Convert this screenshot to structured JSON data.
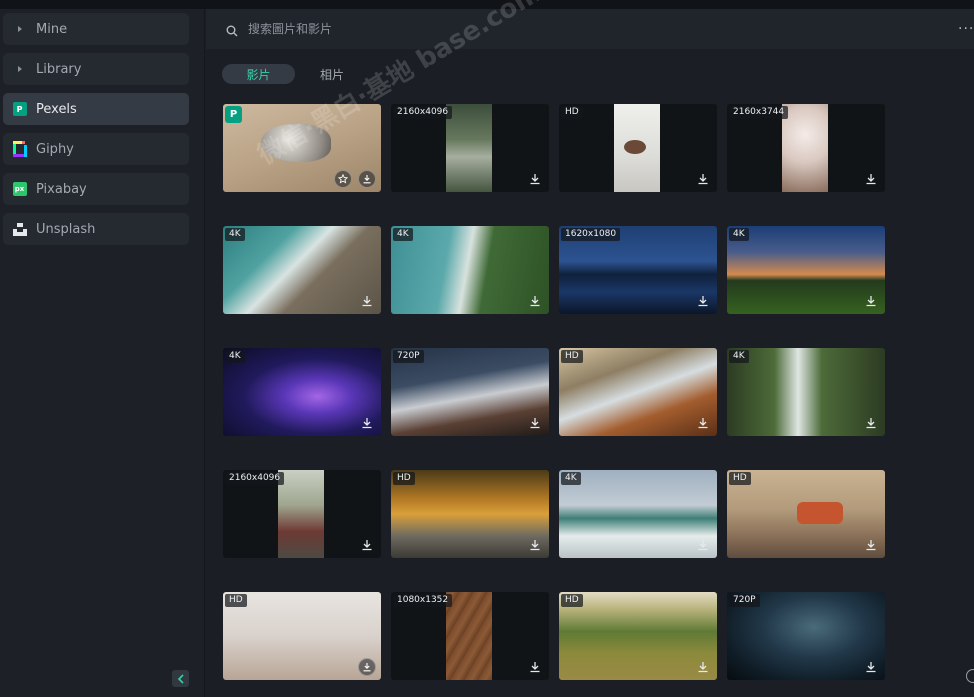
{
  "sidebar": {
    "items": [
      {
        "label": "Mine",
        "icon": "triangle-right-icon"
      },
      {
        "label": "Library",
        "icon": "triangle-right-icon"
      },
      {
        "label": "Pexels",
        "icon": "pexels-logo-icon",
        "active": true
      },
      {
        "label": "Giphy",
        "icon": "giphy-logo-icon"
      },
      {
        "label": "Pixabay",
        "icon": "pixabay-logo-icon"
      },
      {
        "label": "Unsplash",
        "icon": "unsplash-logo-icon"
      }
    ],
    "pexels_glyph": "P",
    "pixabay_glyph": "px"
  },
  "search": {
    "placeholder": "搜索圖片和影片"
  },
  "more_label": "···",
  "tabs": {
    "video": "影片",
    "photo": "相片"
  },
  "watermark": "微信·黑白·基地 base.com",
  "accent": "#33d1a8",
  "grid": [
    {
      "res": "",
      "badge": "P",
      "fav": true
    },
    {
      "res": "2160x4096"
    },
    {
      "res": "HD"
    },
    {
      "res": "2160x3744"
    },
    {
      "res": "4K"
    },
    {
      "res": "4K"
    },
    {
      "res": "1620x1080"
    },
    {
      "res": "4K"
    },
    {
      "res": "4K"
    },
    {
      "res": "720P"
    },
    {
      "res": "HD"
    },
    {
      "res": "4K"
    },
    {
      "res": "2160x4096"
    },
    {
      "res": "HD"
    },
    {
      "res": "4K"
    },
    {
      "res": "HD"
    },
    {
      "res": "HD"
    },
    {
      "res": "1080x1352"
    },
    {
      "res": "HD"
    },
    {
      "res": "720P"
    }
  ]
}
